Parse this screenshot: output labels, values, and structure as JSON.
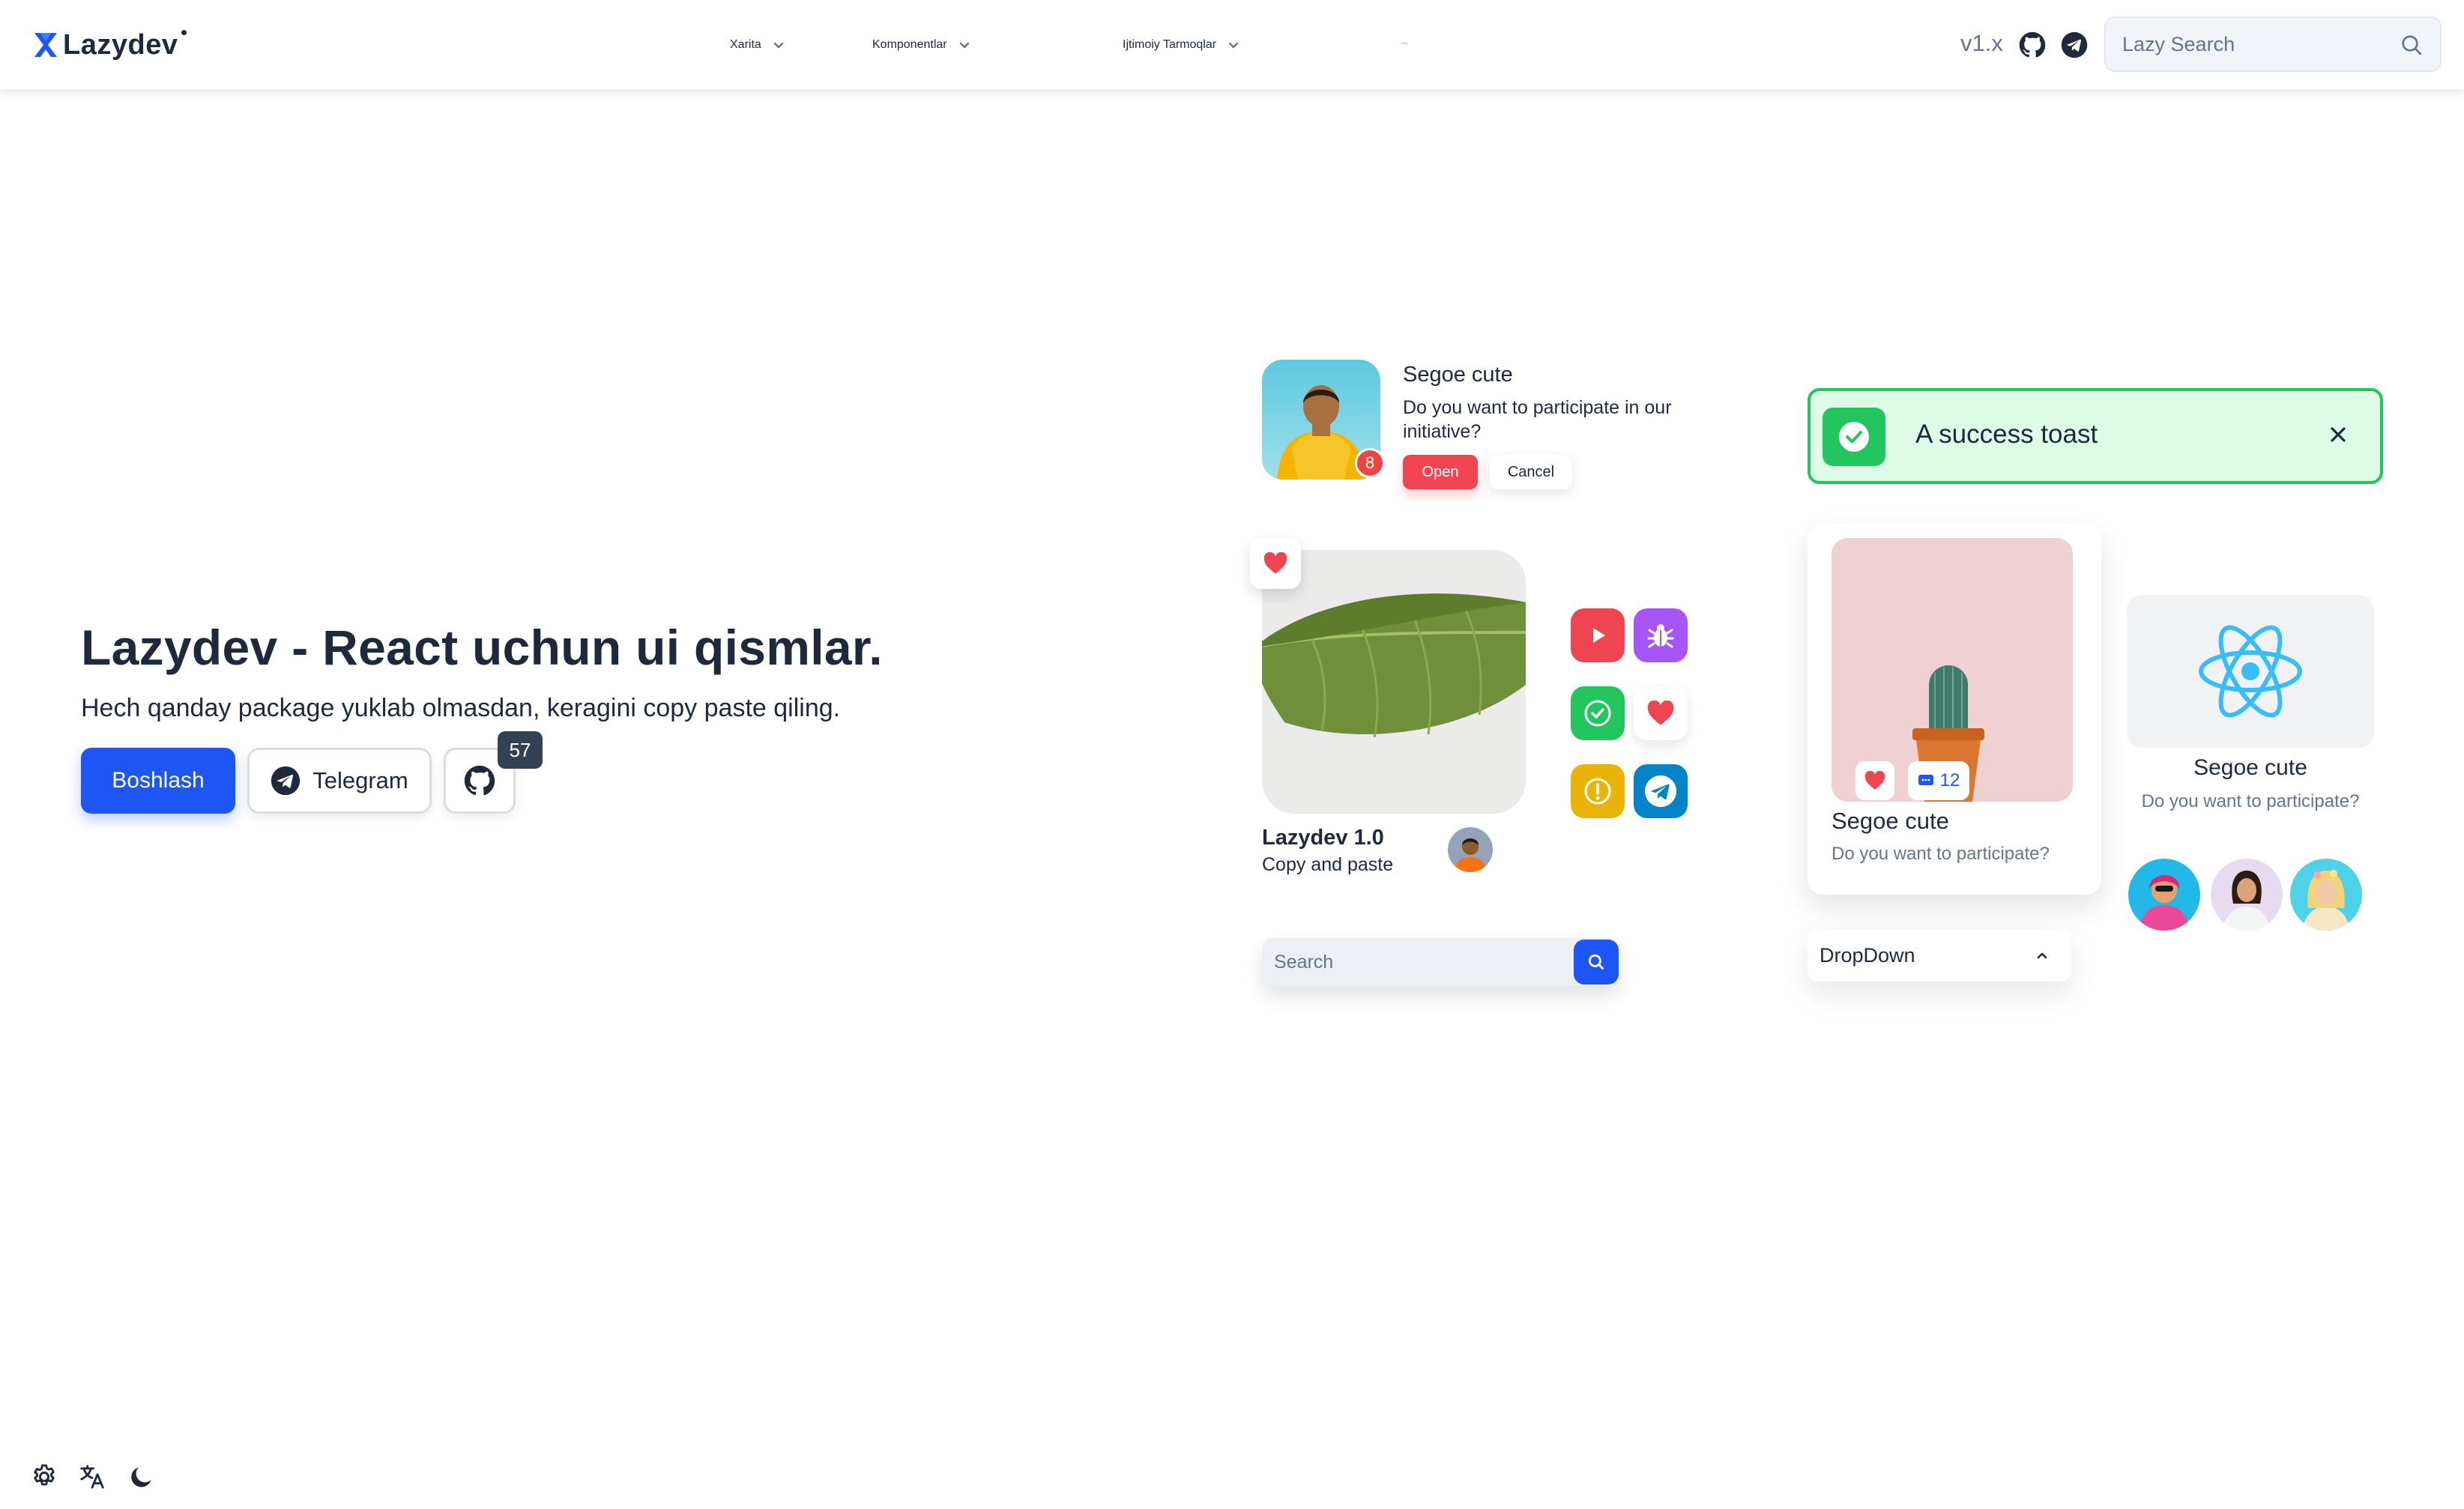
{
  "header": {
    "logo_text": "Lazydev",
    "nav": [
      {
        "label": "Xarita"
      },
      {
        "label": "Komponentlar"
      },
      {
        "label": "Ijtimoiy Tarmoqlar"
      }
    ],
    "version": "v1.x",
    "search_placeholder": "Lazy Search"
  },
  "hero": {
    "title": "Lazydev - React uchun ui qismlar.",
    "subtitle": "Hech qanday package yuklab olmasdan, keragini copy paste qiling.",
    "primary_button": "Boshlash",
    "telegram_button": "Telegram",
    "github_stars": "57"
  },
  "showcase": {
    "notification": {
      "badge": "8",
      "title": "Segoe cute",
      "text": "Do you want to participate in our initiative?",
      "open_label": "Open",
      "cancel_label": "Cancel"
    },
    "toast": {
      "text": "A success toast"
    },
    "leaf_card": {
      "title": "Lazydev 1.0",
      "subtitle": "Copy and paste"
    },
    "mini_search_placeholder": "Search",
    "cactus_card": {
      "count": "12",
      "title": "Segoe cute",
      "subtitle": "Do you want to participate?"
    },
    "dropdown_label": "DropDown",
    "react_card": {
      "title": "Segoe cute",
      "subtitle": "Do you want to participate?"
    }
  },
  "colors": {
    "primary": "#1e55f5",
    "danger": "#ef4451",
    "success": "#22c55e",
    "success_bg": "#dcfce7",
    "text": "#1e293b",
    "muted": "#64748b"
  },
  "icons": [
    "logo-x-icon",
    "chevron-down-icon",
    "github-icon",
    "telegram-icon",
    "search-icon",
    "check-icon",
    "close-icon",
    "heart-icon",
    "play-icon",
    "bug-icon",
    "alert-icon",
    "message-icon",
    "react-icon",
    "gear-icon",
    "translate-icon",
    "moon-icon"
  ]
}
